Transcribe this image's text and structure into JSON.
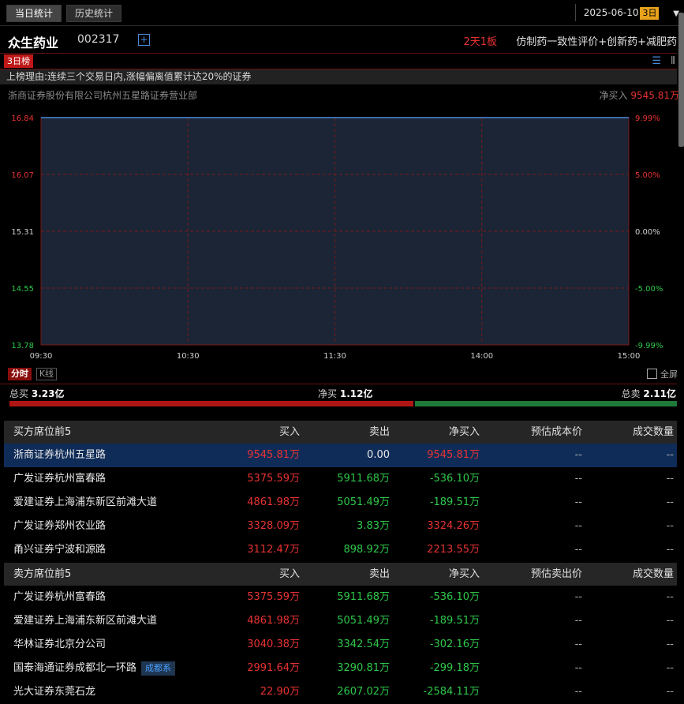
{
  "tabs": [
    "当日统计",
    "历史统计"
  ],
  "date": "2025-06-10",
  "date_badge": "3日",
  "stock": {
    "name": "众生药业",
    "code": "002317",
    "boards": "2天1板",
    "concepts": "仿制药一致性评价+创新药+减肥药"
  },
  "rank_tag": "3日榜",
  "reason": "上榜理由:连续三个交易日内,涨幅偏离值累计达20%的证券",
  "selected_broker": "浙商证券股份有限公司杭州五星路证券营业部",
  "net_buy_label": "净买入",
  "net_buy_value": "9545.81万",
  "chart_data": {
    "type": "line",
    "x_ticks": [
      "09:30",
      "10:30",
      "11:30",
      "14:00",
      "15:00"
    ],
    "y_ticks_left": [
      "16.84",
      "16.07",
      "15.31",
      "14.55",
      "13.78"
    ],
    "y_ticks_right": [
      "9.99%",
      "5.00%",
      "0.00%",
      "-5.00%",
      "-9.99%"
    ],
    "ylim": [
      13.78,
      16.84
    ],
    "series": [
      {
        "values": [
          16.84,
          16.84
        ]
      }
    ]
  },
  "chart_tabs": [
    "分时",
    "K线"
  ],
  "fullscreen": "全屏",
  "totals": {
    "buy_label": "总买",
    "buy": "3.23亿",
    "net_label": "净买",
    "net": "1.12亿",
    "sell_label": "总卖",
    "sell": "2.11亿",
    "buy_ratio": 0.605
  },
  "buy_table": {
    "headers": [
      "买方席位前5",
      "买入",
      "卖出",
      "净买入",
      "预估成本价",
      "成交数量"
    ],
    "rows": [
      {
        "name": "浙商证券杭州五星路",
        "buy": "9545.81万",
        "sell": "0.00",
        "net": "9545.81万",
        "cost": "--",
        "vol": "--"
      },
      {
        "name": "广发证券杭州富春路",
        "buy": "5375.59万",
        "sell": "5911.68万",
        "net": "-536.10万",
        "cost": "--",
        "vol": "--"
      },
      {
        "name": "爱建证券上海浦东新区前滩大道",
        "buy": "4861.98万",
        "sell": "5051.49万",
        "net": "-189.51万",
        "cost": "--",
        "vol": "--"
      },
      {
        "name": "广发证券郑州农业路",
        "buy": "3328.09万",
        "sell": "3.83万",
        "net": "3324.26万",
        "cost": "--",
        "vol": "--"
      },
      {
        "name": "甬兴证券宁波和源路",
        "buy": "3112.47万",
        "sell": "898.92万",
        "net": "2213.55万",
        "cost": "--",
        "vol": "--"
      }
    ]
  },
  "sell_table": {
    "headers": [
      "卖方席位前5",
      "买入",
      "卖出",
      "净买入",
      "预估卖出价",
      "成交数量"
    ],
    "rows": [
      {
        "name": "广发证券杭州富春路",
        "buy": "5375.59万",
        "sell": "5911.68万",
        "net": "-536.10万",
        "cost": "--",
        "vol": "--"
      },
      {
        "name": "爱建证券上海浦东新区前滩大道",
        "buy": "4861.98万",
        "sell": "5051.49万",
        "net": "-189.51万",
        "cost": "--",
        "vol": "--"
      },
      {
        "name": "华林证券北京分公司",
        "buy": "3040.38万",
        "sell": "3342.54万",
        "net": "-302.16万",
        "cost": "--",
        "vol": "--"
      },
      {
        "name": "国泰海通证券成都北一环路",
        "tag": "成都系",
        "buy": "2991.64万",
        "sell": "3290.81万",
        "net": "-299.18万",
        "cost": "--",
        "vol": "--"
      },
      {
        "name": "光大证券东莞石龙",
        "buy": "22.90万",
        "sell": "2607.02万",
        "net": "-2584.11万",
        "cost": "--",
        "vol": "--"
      }
    ]
  },
  "colors": {
    "up": "#e83232",
    "down": "#2ec84a",
    "line": "#4a8ad8",
    "grid": "#7a1a1a",
    "highlight": "#0f2c58"
  }
}
